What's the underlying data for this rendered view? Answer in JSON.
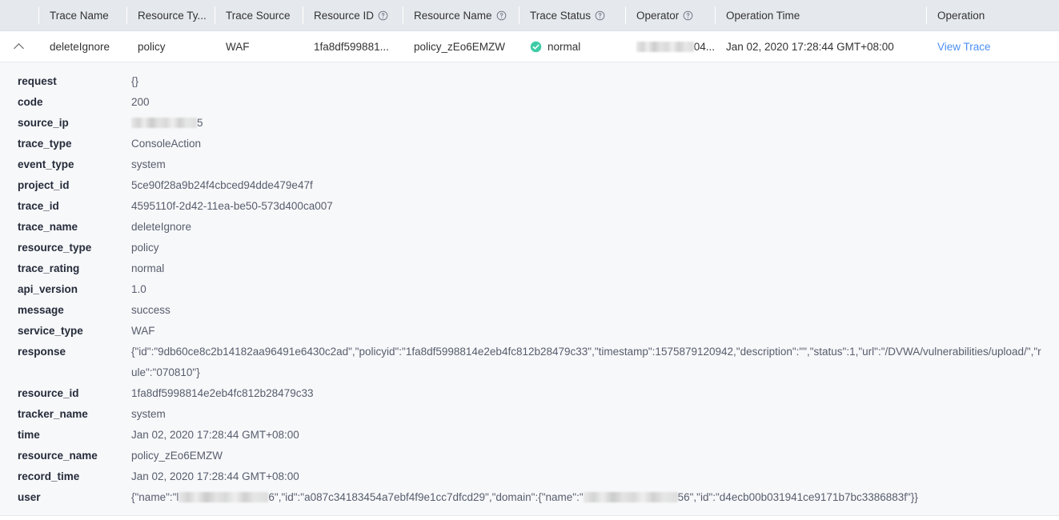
{
  "table": {
    "columns": [
      {
        "key": "expand",
        "label": "",
        "has_help": false
      },
      {
        "key": "trace_name",
        "label": "Trace Name",
        "has_help": false
      },
      {
        "key": "resource_type",
        "label": "Resource Ty...",
        "has_help": false
      },
      {
        "key": "trace_source",
        "label": "Trace Source",
        "has_help": false
      },
      {
        "key": "resource_id",
        "label": "Resource ID",
        "has_help": true
      },
      {
        "key": "resource_name",
        "label": "Resource Name",
        "has_help": true
      },
      {
        "key": "trace_status",
        "label": "Trace Status",
        "has_help": true
      },
      {
        "key": "operator",
        "label": "Operator",
        "has_help": true
      },
      {
        "key": "operation_time",
        "label": "Operation Time",
        "has_help": false
      },
      {
        "key": "operation",
        "label": "Operation",
        "has_help": false
      }
    ],
    "row": {
      "expanded": true,
      "trace_name": "deleteIgnore",
      "resource_type": "policy",
      "trace_source": "WAF",
      "resource_id": "1fa8df599881...",
      "resource_name": "policy_zEo6EMZW",
      "trace_status": "normal",
      "trace_status_color": "#3dcca6",
      "operator_suffix": "04...",
      "operation_time": "Jan 02, 2020 17:28:44 GMT+08:00",
      "operation_link": "View Trace"
    }
  },
  "detail": {
    "rows": [
      {
        "label": "request",
        "value": "{}"
      },
      {
        "label": "code",
        "value": "200"
      },
      {
        "label": "source_ip",
        "value": "5",
        "redacted": "ip"
      },
      {
        "label": "trace_type",
        "value": "ConsoleAction"
      },
      {
        "label": "event_type",
        "value": "system"
      },
      {
        "label": "project_id",
        "value": "5ce90f28a9b24f4cbced94dde479e47f"
      },
      {
        "label": "trace_id",
        "value": "4595110f-2d42-11ea-be50-573d400ca007"
      },
      {
        "label": "trace_name",
        "value": "deleteIgnore"
      },
      {
        "label": "resource_type",
        "value": "policy"
      },
      {
        "label": "trace_rating",
        "value": "normal"
      },
      {
        "label": "api_version",
        "value": "1.0"
      },
      {
        "label": "message",
        "value": "success"
      },
      {
        "label": "service_type",
        "value": "WAF"
      },
      {
        "label": "response",
        "value": "{\"id\":\"9db60ce8c2b14182aa96491e6430c2ad\",\"policyid\":\"1fa8df5998814e2eb4fc812b28479c33\",\"timestamp\":1575879120942,\"description\":\"\",\"status\":1,\"url\":\"/DVWA/vulnerabilities/upload/\",\"rule\":\"070810\"}"
      },
      {
        "label": "resource_id",
        "value": "1fa8df5998814e2eb4fc812b28479c33"
      },
      {
        "label": "tracker_name",
        "value": "system"
      },
      {
        "label": "time",
        "value": "Jan 02, 2020 17:28:44 GMT+08:00"
      },
      {
        "label": "resource_name",
        "value": "policy_zEo6EMZW"
      },
      {
        "label": "record_time",
        "value": "Jan 02, 2020 17:28:44 GMT+08:00"
      },
      {
        "label": "user",
        "value": "",
        "redacted": "user"
      }
    ],
    "user_parts": {
      "prefix": "{\"name\":\"l",
      "after_name": "6\",\"id\":\"a087c34183454a7ebf4f9e1cc7dfcd29\",\"domain\":{\"name\":\"",
      "after_domain": "56\",\"id\":\"d4ecb00b031941ce9171b7bc3386883f\"}}"
    },
    "source_ip_suffix": "5"
  },
  "icons": {
    "expand_chevron": "chevron-up-icon",
    "help": "help-circle-icon",
    "status_ok": "check-circle-icon"
  }
}
